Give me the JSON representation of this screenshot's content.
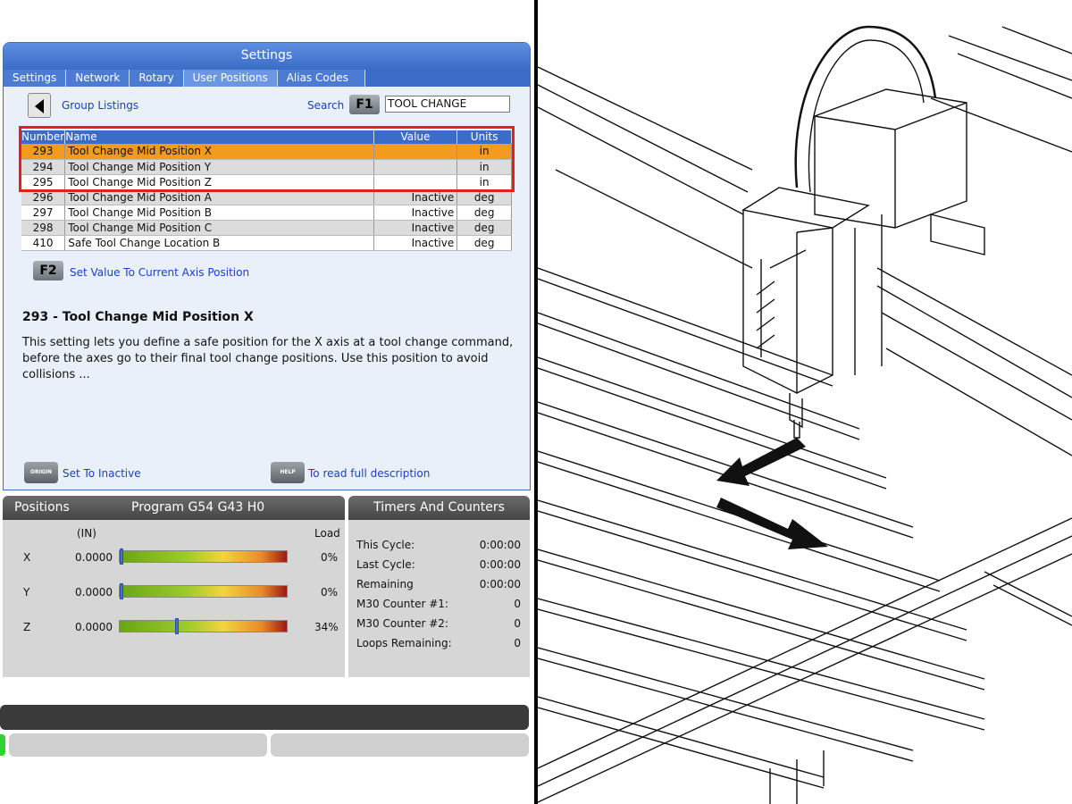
{
  "settings": {
    "title": "Settings",
    "tabs": [
      "Settings",
      "Network",
      "Rotary",
      "User Positions",
      "Alias Codes"
    ],
    "group_listings": "Group Listings",
    "search_label": "Search",
    "search_key": "F1",
    "search_value": "TOOL CHANGE",
    "columns": [
      "Number",
      "Name",
      "Value",
      "Units"
    ],
    "rows": [
      {
        "number": "293",
        "name": "Tool Change Mid Position X",
        "value": "",
        "units": "in"
      },
      {
        "number": "294",
        "name": "Tool Change Mid Position Y",
        "value": "",
        "units": "in"
      },
      {
        "number": "295",
        "name": "Tool Change Mid Position Z",
        "value": "",
        "units": "in"
      },
      {
        "number": "296",
        "name": "Tool Change Mid Position A",
        "value": "Inactive",
        "units": "deg"
      },
      {
        "number": "297",
        "name": "Tool Change Mid Position B",
        "value": "Inactive",
        "units": "deg"
      },
      {
        "number": "298",
        "name": "Tool Change Mid Position C",
        "value": "Inactive",
        "units": "deg"
      },
      {
        "number": "410",
        "name": "Safe Tool Change Location B",
        "value": "Inactive",
        "units": "deg"
      }
    ],
    "f2_key": "F2",
    "f2_label": "Set Value To Current Axis Position",
    "desc_title": "293 - Tool Change Mid Position X",
    "desc_body": "This setting lets you define a safe position for the X axis at a tool change command, before the axes go to their final tool change positions. Use this position to avoid collisions ...",
    "origin_key": "ORIGIN",
    "origin_label": "Set To Inactive",
    "help_key": "HELP",
    "help_label": "To read full description"
  },
  "positions": {
    "title": "Positions",
    "program": "Program G54 G43 H0",
    "unit_header": "(IN)",
    "load_header": "Load",
    "axes": [
      {
        "axis": "X",
        "value": "0.0000",
        "load": "0%",
        "load_fraction": 0.0
      },
      {
        "axis": "Y",
        "value": "0.0000",
        "load": "0%",
        "load_fraction": 0.0
      },
      {
        "axis": "Z",
        "value": "0.0000",
        "load": "34%",
        "load_fraction": 0.34
      }
    ]
  },
  "timers": {
    "title": "Timers And Counters",
    "items": [
      {
        "label": "This Cycle:",
        "value": "0:00:00"
      },
      {
        "label": "Last Cycle:",
        "value": "0:00:00"
      },
      {
        "label": "Remaining",
        "value": "0:00:00"
      },
      {
        "label": "M30 Counter #1:",
        "value": "0"
      },
      {
        "label": "M30 Counter #2:",
        "value": "0"
      },
      {
        "label": "Loops Remaining:",
        "value": "0"
      }
    ]
  },
  "colors": {
    "highlight": "#e32020",
    "selected_row": "#f39a1f",
    "header_blue": "#3b6dc8"
  }
}
